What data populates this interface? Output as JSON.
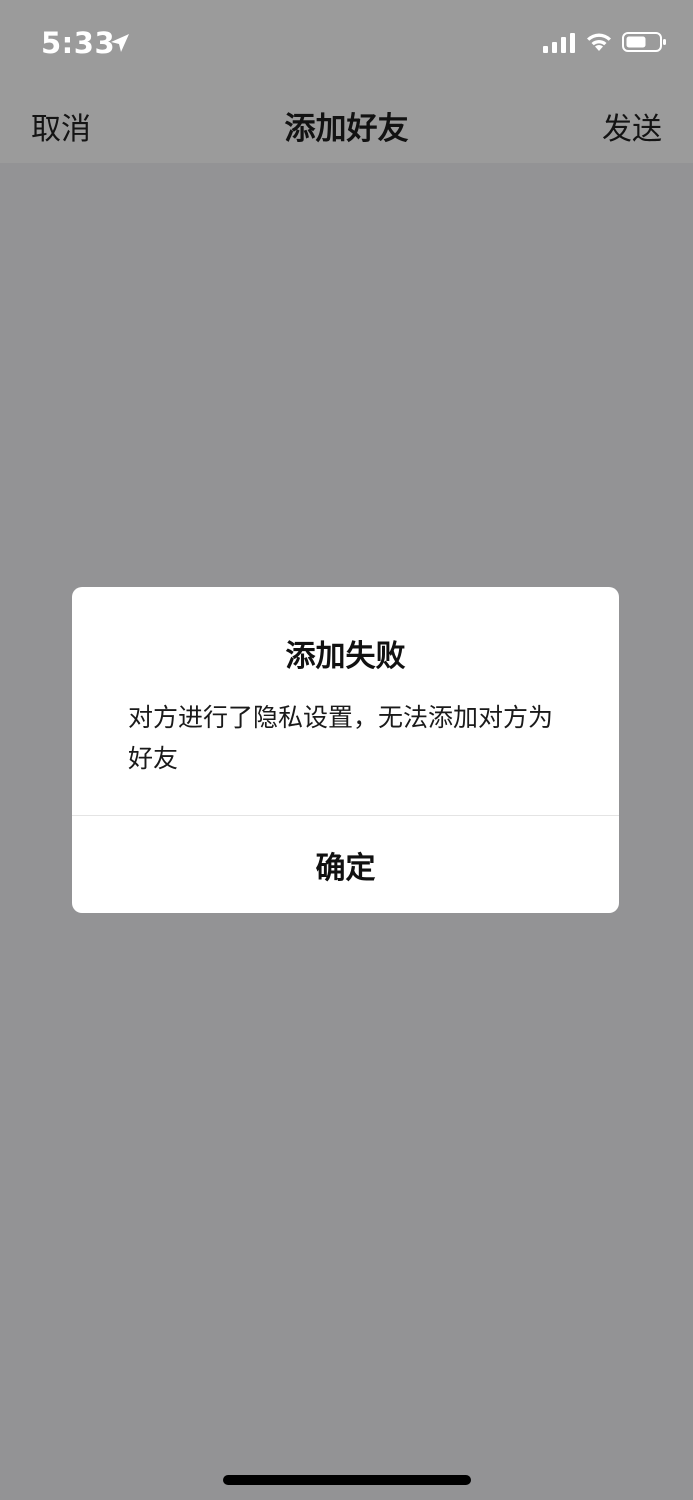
{
  "status_bar": {
    "time": "5:33",
    "icons": [
      "location-arrow-icon",
      "cellular-signal-icon",
      "wifi-icon",
      "battery-icon"
    ]
  },
  "nav": {
    "cancel_label": "取消",
    "title": "添加好友",
    "send_label": "发送"
  },
  "dialog": {
    "title": "添加失败",
    "message": "对方进行了隐私设置，无法添加对方为好友",
    "confirm_label": "确定"
  },
  "colors": {
    "overlay": "#939395",
    "dialog_bg": "#ffffff",
    "text": "#111111"
  }
}
